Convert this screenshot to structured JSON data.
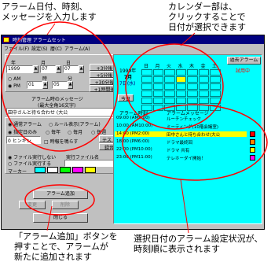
{
  "annotations": {
    "top_left": [
      "アラーム日付、時刻、",
      "メッセージを入力します"
    ],
    "top_right": [
      "カレンダー部は、",
      "クリックすることで",
      "日付が選択できます"
    ],
    "bottom_left": [
      "「アラーム追加」ボタンを",
      "押すことで、アラームが",
      "新たに追加されます"
    ],
    "bottom_right": [
      "選択日付のアラーム設定状況が、",
      "時刻順に表示されます"
    ]
  },
  "window": {
    "title": "時刻管理 アラームセット",
    "menu": [
      "ファイル(F)",
      "設定(S)",
      "暦(C)",
      "アラーム(A)"
    ]
  },
  "date": {
    "year_label": "年",
    "month_label": "月",
    "day_label": "日",
    "year": "1999",
    "month": "07",
    "day": "07",
    "hour_label": "時",
    "minute_label": "分",
    "hour": "01",
    "minute": "05",
    "am_label": "AM",
    "pm_label": "PM",
    "offset_buttons": [
      "+3分後",
      "+5分後",
      "+30分後",
      "+1時間後"
    ]
  },
  "message": {
    "label": "アラーム時のメッセージ",
    "hint": "(最大全角16文字)",
    "value": "田中さんと待ち合わせ (大公"
  },
  "options": {
    "normal_alarm": "通常アラーム",
    "rule_alarm": "ルール表示(アラーム)",
    "fixed_date": "指定日のみ",
    "every_year": "毎年",
    "every_month": "毎月",
    "every_week": "毎週",
    "repeat_label": "0 ヒンギン",
    "repeat_desc": "時報を鳴らす",
    "test_label": "テスト",
    "record_label": "録音",
    "file_none": "ファイル実行しない",
    "file_exec": "ファイル実行する",
    "exec_file_label": "実行ファイル名",
    "marker_label": "マーカー"
  },
  "buttons": {
    "add": "アラーム追加",
    "change": "変更",
    "delete": "削除",
    "close": "閉じる",
    "history": "過去アラーム",
    "today": "今日"
  },
  "calendar": {
    "year_text": "1999年",
    "month_text": "7月",
    "day_text": "7日(水)",
    "weekdays": [
      "日",
      "月",
      "火",
      "水",
      "木",
      "金",
      "土"
    ],
    "status": "試用中"
  },
  "alarm_list": {
    "col_time": "アラーム時刻",
    "col_msg": "アラームメッセージ",
    "rows": [
      {
        "time": "09:00 (AM9:00)",
        "msg": "ルーチンチェック"
      },
      {
        "time": "10:00 (AM10:00)",
        "msg": "ミーティング(10階会議室)"
      },
      {
        "time": "14:00 (PM2:00)",
        "msg": "田中さんと待ち合わせ(大公"
      },
      {
        "time": "18:00 (PM6:00)",
        "msg": "ドラマ最終回"
      },
      {
        "time": "22:00 (PM10:00)",
        "msg": "ドラマ 共有"
      },
      {
        "time": "23:00 (PM11:00)",
        "msg": "テレホーダイ開始！"
      }
    ]
  },
  "colors": {
    "calendar_bg": "#00ffff",
    "list_bg": "#00ffff",
    "selected_row": "#ffff00",
    "annotation_red": "#ff0000"
  }
}
